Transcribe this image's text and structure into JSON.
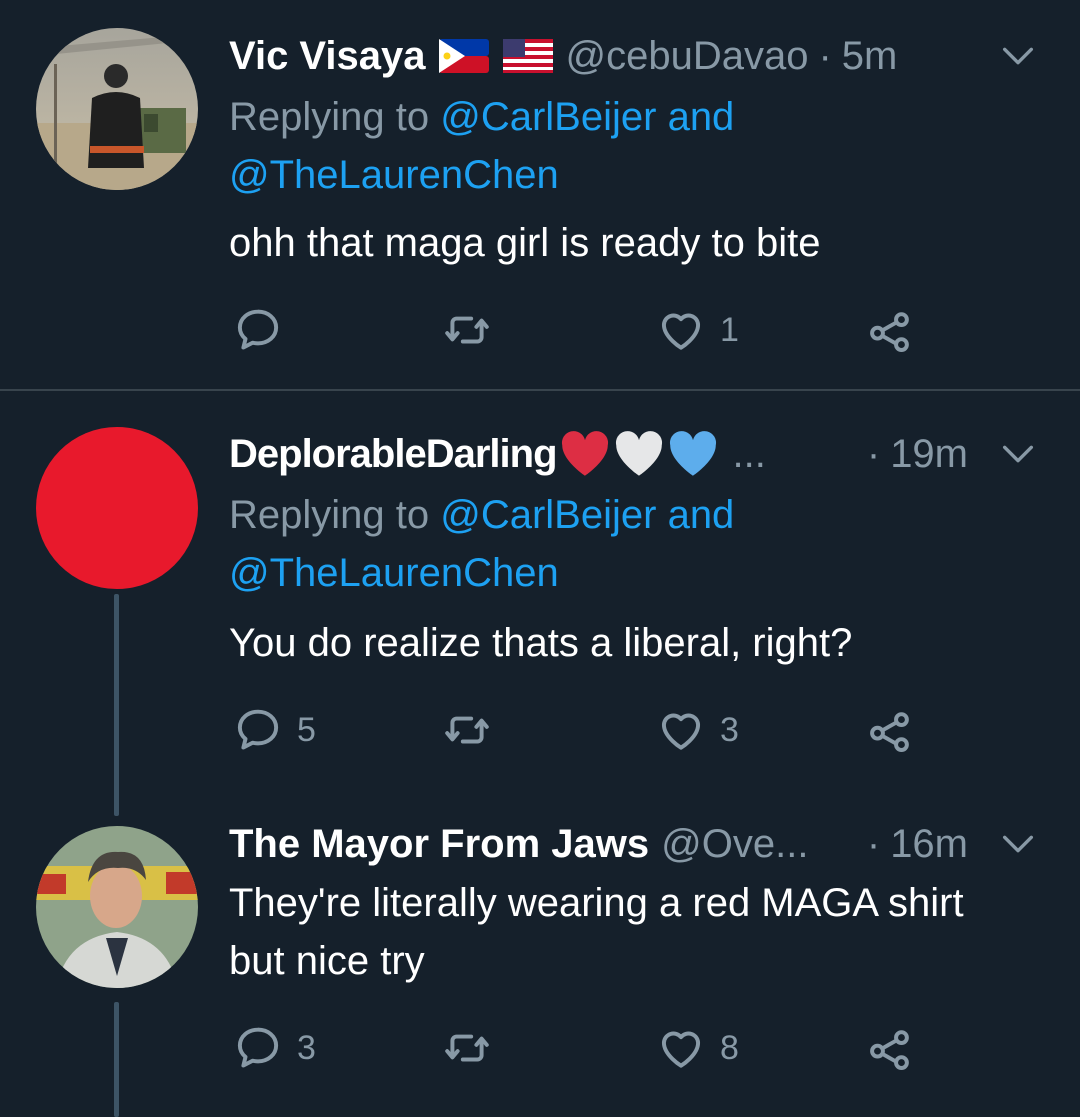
{
  "tweets": [
    {
      "name": "Vic Visaya",
      "handle": "@cebuDavao",
      "time": "5m",
      "replying_prefix": "Replying to ",
      "replying_user1": "@CarlBeijer",
      "replying_and": " and",
      "replying_user2": "@TheLaurenChen",
      "text": "ohh that maga girl is ready to bite",
      "replies": "",
      "retweets": "",
      "likes": "1",
      "flags": [
        "philippines-flag",
        "usa-flag"
      ]
    },
    {
      "name": "DeplorableDarling",
      "handle": "...",
      "time": "19m",
      "replying_prefix": "Replying to ",
      "replying_user1": "@CarlBeijer",
      "replying_and": " and",
      "replying_user2": "@TheLaurenChen",
      "text": "You do realize thats a liberal, right?",
      "replies": "5",
      "retweets": "",
      "likes": "3",
      "emoji": [
        "red-heart",
        "white-heart",
        "blue-heart"
      ],
      "avatar_color": "#e8192c"
    },
    {
      "name": "The Mayor From Jaws",
      "handle": "@Ove...",
      "time": "16m",
      "text_line1": "They're literally wearing a red MAGA shirt",
      "text_line2": "but nice try",
      "replies": "3",
      "retweets": "",
      "likes": "8"
    }
  ],
  "separator": "·",
  "icons": [
    "reply-icon",
    "retweet-icon",
    "like-icon",
    "share-icon",
    "chevron-down-icon"
  ],
  "colors": {
    "background": "#15202b",
    "secondary_text": "#8899a6",
    "link": "#1da1f2",
    "divider": "#38444d"
  }
}
